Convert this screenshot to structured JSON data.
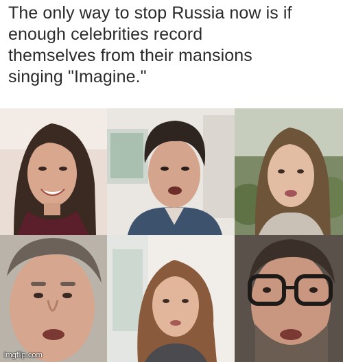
{
  "meme": {
    "caption_lines": [
      "The only way to stop Russia now is if",
      "enough celebrities record",
      "themselves from their mansions",
      "singing \"Imagine.\""
    ],
    "watermark": "imgflip.com"
  },
  "colors": {
    "caption_text": "#2a2a2a",
    "background": "#ffffff"
  }
}
